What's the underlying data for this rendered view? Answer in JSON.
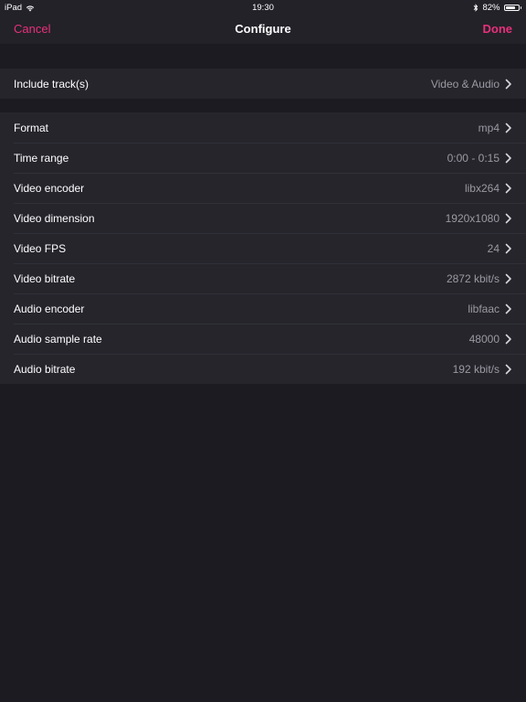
{
  "status_bar": {
    "device": "iPad",
    "time": "19:30",
    "battery_percent": "82%",
    "battery_level": 0.82,
    "icons": [
      "wifi-icon",
      "bluetooth-icon",
      "battery-icon"
    ]
  },
  "nav": {
    "cancel_label": "Cancel",
    "title": "Configure",
    "done_label": "Done"
  },
  "colors": {
    "accent": "#e8307b",
    "background": "#1c1b22",
    "cell": "#26252c",
    "value_text": "#9b9aa2"
  },
  "group1": {
    "rows": [
      {
        "label": "Include track(s)",
        "value": "Video & Audio"
      }
    ]
  },
  "group2": {
    "rows": [
      {
        "label": "Format",
        "value": "mp4"
      },
      {
        "label": "Time range",
        "value": "0:00 - 0:15"
      },
      {
        "label": "Video encoder",
        "value": "libx264"
      },
      {
        "label": "Video dimension",
        "value": "1920x1080"
      },
      {
        "label": "Video FPS",
        "value": "24"
      },
      {
        "label": "Video bitrate",
        "value": "2872 kbit/s"
      },
      {
        "label": "Audio encoder",
        "value": "libfaac"
      },
      {
        "label": "Audio sample rate",
        "value": "48000"
      },
      {
        "label": "Audio bitrate",
        "value": "192 kbit/s"
      }
    ]
  }
}
